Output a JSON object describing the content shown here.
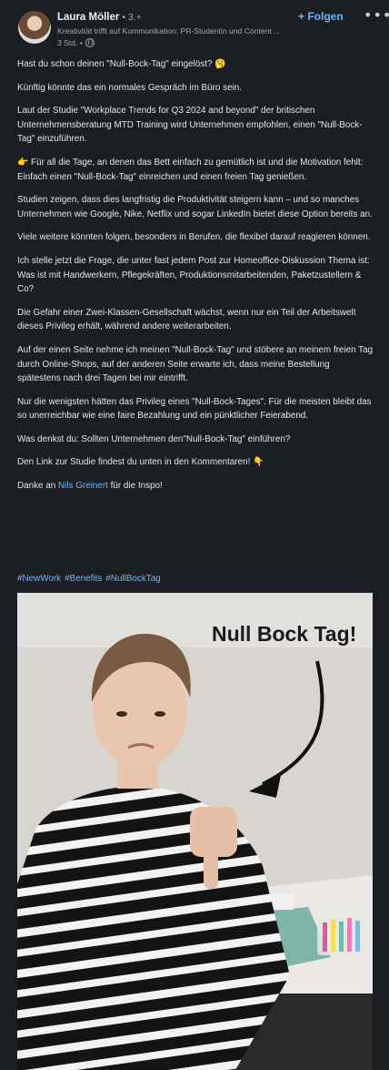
{
  "author": {
    "name": "Laura Möller",
    "degree": "• 3.+",
    "headline": "Kreativität trifft auf Kommunikation: PR-Studentin und Content ...",
    "time": "3 Std. •"
  },
  "actions": {
    "follow_label": "+ Folgen",
    "more_label": "•••"
  },
  "post": {
    "paragraphs": [
      "Hast du schon deinen \"Null-Bock-Tag\" eingelöst? 🥱",
      "Künftig könnte das ein normales Gespräch im Büro sein.",
      "Laut der Studie \"Workplace Trends for Q3 2024 and beyond\" der britischen Unternehmensberatung MTD Training wird Unternehmen empfohlen, einen \"Null-Bock-Tag\" einzuführen.",
      "👉 Für all die Tage, an denen das Bett einfach zu gemütlich ist und die Motivation fehlt: Einfach einen \"Null-Bock-Tag\" einreichen und einen freien Tag genießen.",
      "Studien zeigen, dass dies langfristig die Produktivität steigern kann – und so manches Unternehmen wie Google, Nike, Netflix und sogar LinkedIn bietet diese Option bereits an.",
      "Viele weitere könnten folgen, besonders in Berufen, die flexibel darauf reagieren können.",
      "Ich stelle jetzt die Frage, die unter fast jedem Post zur Homeoffice-Diskussion Thema ist: Was ist mit Handwerkern, Pflegekräften, Produktionsmitarbeitenden, Paketzustellern & Co?",
      "Die Gefahr einer Zwei-Klassen-Gesellschaft wächst, wenn nur ein Teil der Arbeitswelt dieses Privileg erhält, während andere weiterarbeiten.",
      "Auf der einen Seite nehme ich meinen \"Null-Bock-Tag\" und stöbere an meinem freien Tag durch Online-Shops, auf der anderen Seite erwarte ich, dass meine Bestellung spätestens nach drei Tagen bei mir eintrifft.",
      "Nur die wenigsten hätten das Privileg eines \"Null-Bock-Tages\". Für die meisten bleibt das so unerreichbar wie eine faire Bezahlung und ein pünktlicher Feierabend.",
      "Was denkst du: Sollten Unternehmen den\"Null-Bock-Tag\" einführen?",
      "Den Link zur Studie findest du unten in den Kommentaren! 👇"
    ],
    "thanks_prefix": "Danke an ",
    "thanks_mention": "Nils Greinert",
    "thanks_suffix": " für die Inspo!",
    "hashtags": [
      "#NewWork",
      "#Benefits",
      "#NullBockTag"
    ]
  },
  "image": {
    "overlay_text": "Null Bock Tag!",
    "colors": {
      "sweater": "#141414",
      "stripe": "#f2f2f2",
      "desk_mat": "#7fb5a8",
      "wall": "#d8d5d1"
    }
  }
}
